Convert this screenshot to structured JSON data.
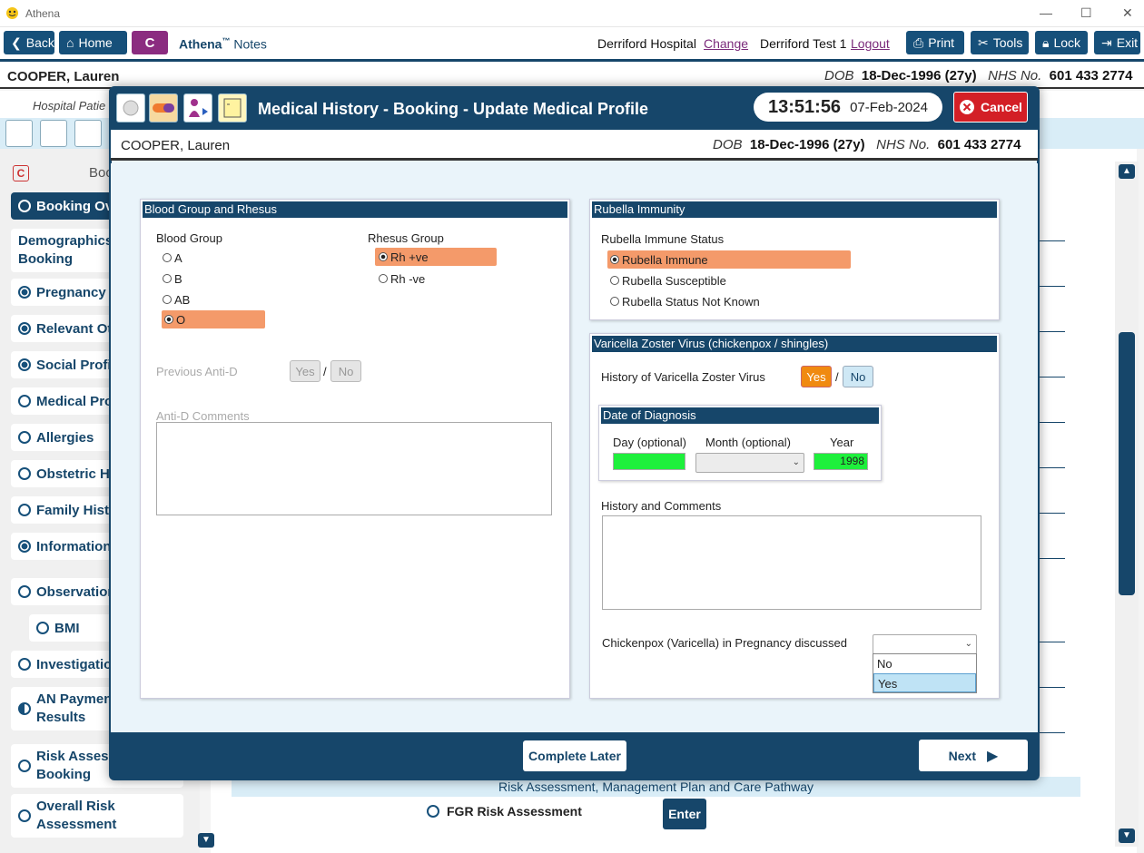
{
  "window": {
    "title": "Athena",
    "minimize": "—",
    "maximize": "☐",
    "close": "✕"
  },
  "nav": {
    "back": "Back",
    "home": "Home",
    "c_label": "C",
    "app_name": "Athena",
    "app_tm": "™",
    "app_notes": "Notes",
    "hospital": "Derriford Hospital",
    "change": "Change",
    "user": "Derriford Test 1",
    "logout": "Logout",
    "print": "Print",
    "tools": "Tools",
    "lock": "Lock",
    "exit": "Exit"
  },
  "patient": {
    "name": "COOPER, Lauren",
    "dob_label": "DOB",
    "dob": "18-Dec-1996 (27y)",
    "nhs_label": "NHS No.",
    "nhs": "601 433 2774"
  },
  "background": {
    "hospital_patient": "Hospital Patie",
    "section_label": "Boo",
    "sidebar": [
      {
        "label": "Booking Ov",
        "state": "empty"
      },
      {
        "label": "Demographics",
        "label2": "Booking",
        "state": "none"
      },
      {
        "label": "Pregnancy P",
        "state": "on"
      },
      {
        "label": "Relevant Oth",
        "state": "on"
      },
      {
        "label": "Social Profile",
        "state": "on"
      },
      {
        "label": "Medical Pro",
        "state": "empty"
      },
      {
        "label": "Allergies",
        "state": "empty"
      },
      {
        "label": "Obstetric Hi",
        "state": "empty"
      },
      {
        "label": "Family Histo",
        "state": "empty"
      },
      {
        "label": "Information",
        "state": "on"
      },
      {
        "label": "Observation",
        "state": "empty"
      },
      {
        "label": "BMI",
        "state": "empty"
      },
      {
        "label": "Investigation",
        "state": "empty"
      },
      {
        "label": "AN Paymen",
        "label2": "Results",
        "state": "half"
      },
      {
        "label": "Risk Assessr",
        "label2": "Booking",
        "state": "empty"
      },
      {
        "label": "Overall Risk",
        "label2": "Assessment",
        "state": "empty"
      }
    ],
    "risk_header": "Risk Assessment, Management Plan and Care Pathway",
    "fgr": "FGR Risk Assessment",
    "enter": "Enter"
  },
  "modal": {
    "title": "Medical History - Booking - Update Medical Profile",
    "time": "13:51:56",
    "date": "07-Feb-2024",
    "cancel": "Cancel",
    "blood": {
      "header": "Blood Group and Rhesus",
      "group_label": "Blood Group",
      "groups": [
        "A",
        "B",
        "AB",
        "O"
      ],
      "group_selected": "O",
      "rhesus_label": "Rhesus Group",
      "rhesus": [
        "Rh +ve",
        "Rh -ve"
      ],
      "rhesus_selected": "Rh +ve",
      "anti_d_label": "Previous Anti-D",
      "yes": "Yes",
      "sep": "/",
      "no": "No",
      "anti_d_comments": "Anti-D Comments"
    },
    "rubella": {
      "header": "Rubella Immunity",
      "label": "Rubella Immune Status",
      "options": [
        "Rubella Immune",
        "Rubella Susceptible",
        "Rubella Status Not Known"
      ],
      "selected": "Rubella Immune"
    },
    "varicella": {
      "header": "Varicella Zoster Virus (chickenpox / shingles)",
      "history_label": "History of Varicella Zoster Virus",
      "yes": "Yes",
      "sep": "/",
      "no": "No",
      "selected": "Yes",
      "diag_header": "Date of Diagnosis",
      "day_label": "Day (optional)",
      "month_label": "Month (optional)",
      "year_label": "Year",
      "day_value": "",
      "month_value": "",
      "year_value": "1998",
      "comments_label": "History and Comments",
      "pregnancy_label": "Chickenpox (Varicella) in Pregnancy discussed",
      "pregnancy_options": [
        "No",
        "Yes"
      ],
      "pregnancy_highlight": "Yes"
    },
    "complete_later": "Complete Later",
    "next": "Next"
  }
}
